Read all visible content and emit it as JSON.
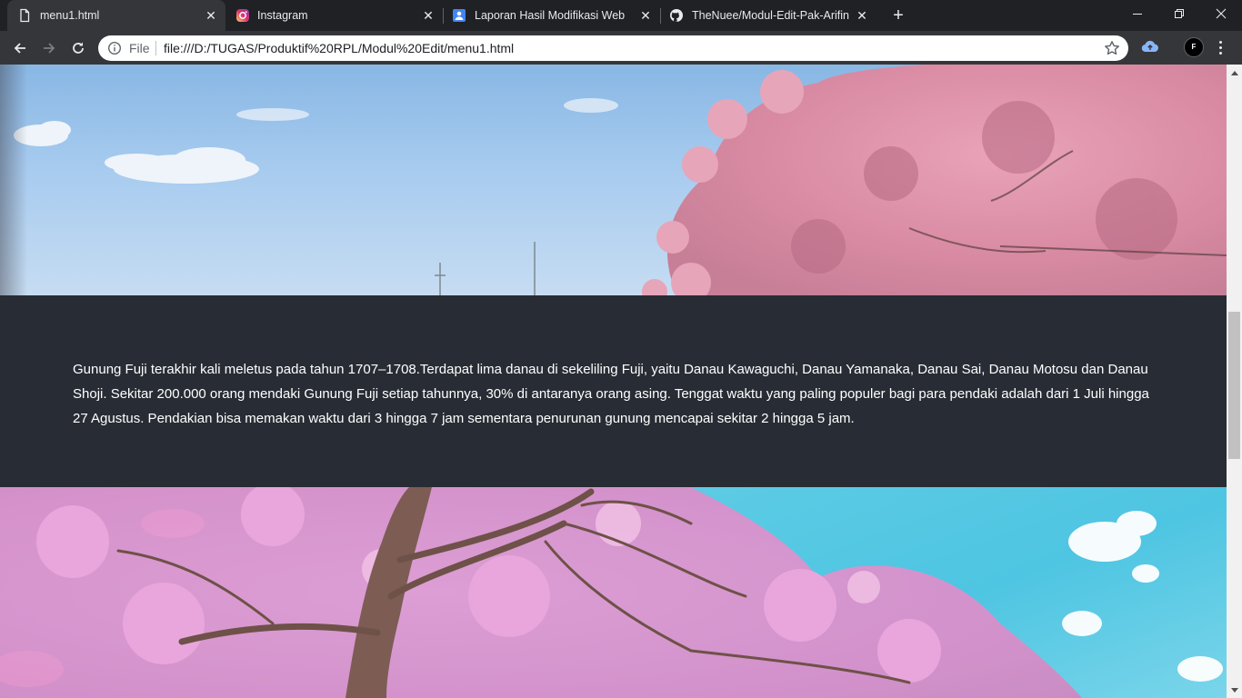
{
  "tabs": [
    {
      "title": "menu1.html",
      "icon": "document-icon",
      "active": true
    },
    {
      "title": "Instagram",
      "icon": "instagram-icon",
      "active": false
    },
    {
      "title": "Laporan Hasil Modifikasi Web",
      "icon": "google-sites-icon",
      "active": false
    },
    {
      "title": "TheNuee/Modul-Edit-Pak-Arifin",
      "icon": "github-icon",
      "active": false
    }
  ],
  "address_bar": {
    "scheme_label": "File",
    "url": "file:///D:/TUGAS/Produktif%20RPL/Modul%20Edit/menu1.html"
  },
  "profile": {
    "initial": "F"
  },
  "page": {
    "paragraph": "Gunung Fuji terakhir kali meletus pada tahun 1707–1708.Terdapat lima danau di sekeliling Fuji, yaitu Danau Kawaguchi, Danau Yamanaka, Danau Sai, Danau Motosu dan Danau Shoji. Sekitar 200.000 orang mendaki Gunung Fuji setiap tahunnya, 30% di antaranya orang asing. Tenggat waktu yang paling populer bagi para pendaki adalah dari 1 Juli hingga 27 Agustus. Pendakian bisa memakan waktu dari 3 hingga 7 jam sementara penurunan gunung mencapai sekitar 2 hingga 5 jam."
  },
  "colors": {
    "chrome_dark": "#202124",
    "toolbar": "#35363a",
    "section_bg": "#282c34",
    "text": "#ffffff"
  }
}
